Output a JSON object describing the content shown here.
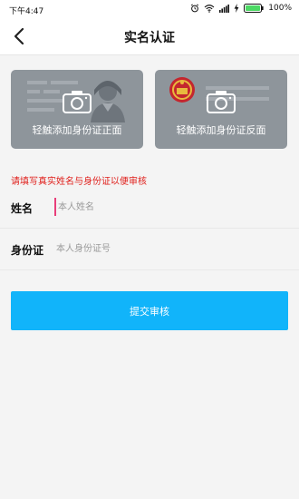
{
  "status_bar": {
    "time": "下午4:47",
    "battery_label": "100%",
    "icons": [
      "alarm-icon",
      "wifi-icon",
      "signal-icon",
      "charging-icon",
      "battery-icon"
    ]
  },
  "nav": {
    "title": "实名认证",
    "back_icon": "chevron-left-icon"
  },
  "id_cards": {
    "front_label": "轻触添加身份证正面",
    "back_label": "轻触添加身份证反面",
    "camera_icon": "camera-icon"
  },
  "tip": "请填写真实姓名与身份证以便审核",
  "form": {
    "name_label": "姓名",
    "name_placeholder": "本人姓名",
    "name_value": "",
    "id_label": "身份证",
    "id_placeholder": "本人身份证号",
    "id_value": ""
  },
  "submit_label": "提交审核",
  "colors": {
    "accent": "#11b4fa",
    "tip_red": "#e0201c",
    "card_gray": "#8e959b",
    "cursor_pink": "#e83e7a"
  }
}
